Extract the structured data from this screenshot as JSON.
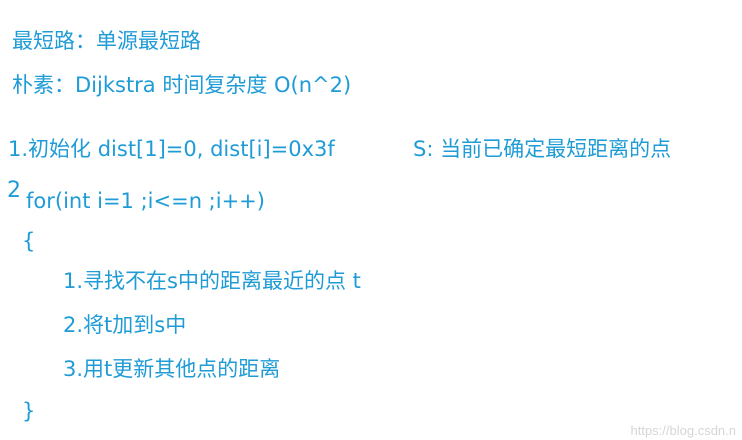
{
  "title_line": "最短路：单源最短路",
  "method_line": "朴素：Dijkstra   时间复杂度 O(n^2)",
  "step1_init": "1.初始化 dist[1]=0, dist[i]=0x3f",
  "step1_note": "S: 当前已确定最短距离的点",
  "step2_number": "2",
  "loop_header": "for(int i=1 ;i<=n ;i++)",
  "open_brace": "{",
  "loop_steps": [
    "1.寻找不在s中的距离最近的点 t",
    "2.将t加到s中",
    "3.用t更新其他点的距离"
  ],
  "close_brace": "}",
  "watermark": "https://blog.csdn.n",
  "colors": {
    "text": "#1f9bd6",
    "background": "#ffffff"
  }
}
